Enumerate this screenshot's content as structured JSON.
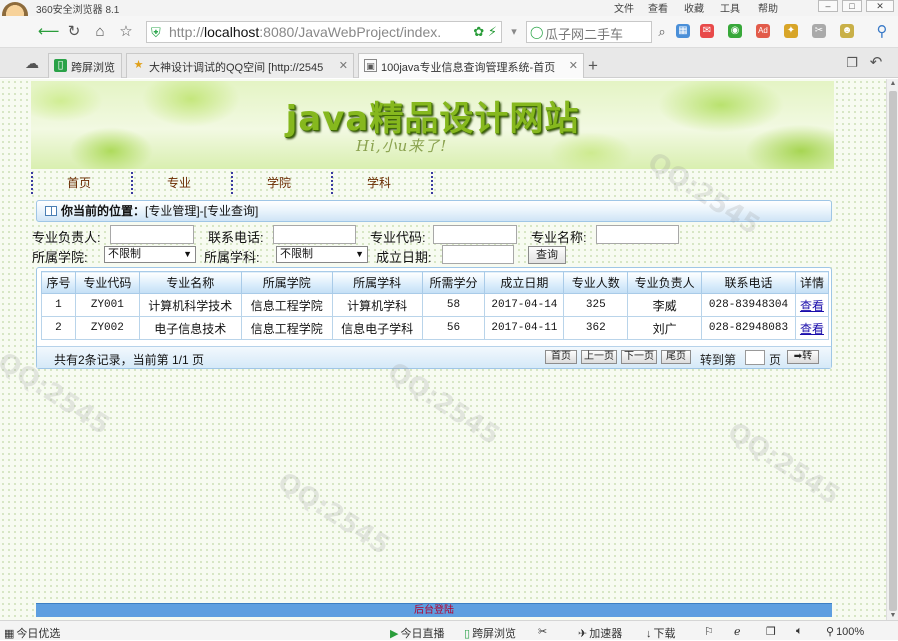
{
  "browser": {
    "app_title": "360安全浏览器 8.1",
    "menu": [
      "文件",
      "查看",
      "收藏",
      "工具",
      "帮助"
    ],
    "url": "http://localhost:8080/JavaWebProject/index.",
    "url_prefix": "http://",
    "url_host": "localhost",
    "url_rest": ":8080/JavaWebProject/index.",
    "search_text": "瓜子网二手车",
    "tabs": [
      {
        "label": "跨屏浏览",
        "active": false
      },
      {
        "label": "大神设计调试的QQ空间 [http://2545",
        "active": false
      },
      {
        "label": "100java专业信息查询管理系统-首页",
        "active": true
      }
    ],
    "zoom": "100%",
    "status_left": "今日优选",
    "status_items": [
      "今日直播",
      "跨屏浏览",
      "加速器",
      "下载"
    ]
  },
  "page": {
    "banner_title": "java精品设计网站",
    "banner_sub": "Hi,小u来了!",
    "nav": [
      "首页",
      "专业",
      "学院",
      "学科"
    ],
    "location_label": "你当前的位置：",
    "location_path": "[专业管理]-[专业查询]",
    "form": {
      "row1": [
        "专业负责人:",
        "联系电话:",
        "专业代码:",
        "专业名称:"
      ],
      "row2": [
        "所属学院:",
        "所属学科:",
        "成立日期:"
      ],
      "college_select": "不限制",
      "subject_select": "不限制",
      "query_button": "查询"
    },
    "table": {
      "headers": [
        "序号",
        "专业代码",
        "专业名称",
        "所属学院",
        "所属学科",
        "所需学分",
        "成立日期",
        "专业人数",
        "专业负责人",
        "联系电话",
        "详情"
      ],
      "rows": [
        [
          "1",
          "ZY001",
          "计算机科学技术",
          "信息工程学院",
          "计算机学科",
          "58",
          "2017-04-14",
          "325",
          "李威",
          "028-83948304",
          "查看"
        ],
        [
          "2",
          "ZY002",
          "电子信息技术",
          "信息工程学院",
          "信息电子学科",
          "56",
          "2017-04-11",
          "362",
          "刘广",
          "028-82948083",
          "查看"
        ]
      ]
    },
    "pager": {
      "info": "共有2条记录，当前第 1/1 页",
      "first": "首页",
      "prev": "上一页",
      "next": "下一页",
      "last": "尾页",
      "jump_to": "转到第",
      "page_unit": "页",
      "go": "➡转"
    },
    "footer": "后台登陆"
  }
}
